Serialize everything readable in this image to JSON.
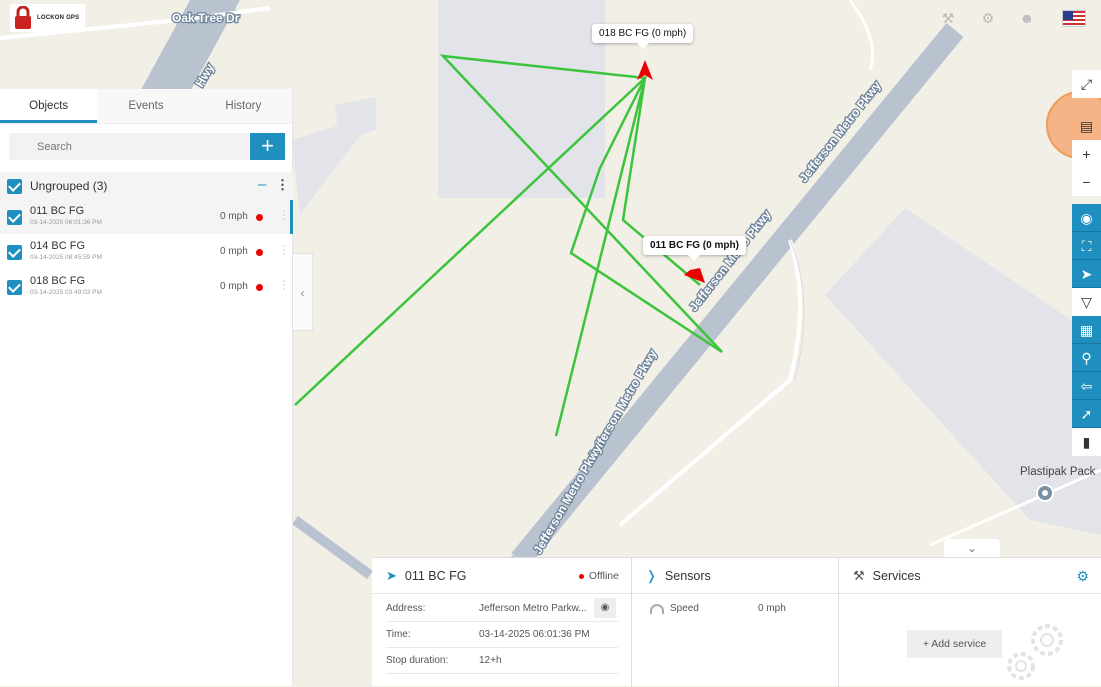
{
  "app": {
    "logo_text": "LOCKON GPS"
  },
  "map": {
    "streets": [
      "Oak Tree Dr",
      "Hwy",
      "Jefferson Metro Pkwy",
      "Jefferson Metro Pkwy",
      "Jefferson Metro Pkwy",
      "Jefferson Metro Pkwy"
    ],
    "poi": "Plastipak Pack",
    "callouts": [
      "018 BC FG (0 mph)",
      "011 BC FG (0 mph)"
    ]
  },
  "tabs": [
    "Objects",
    "Events",
    "History"
  ],
  "search": {
    "placeholder": "Search",
    "add_label": "+"
  },
  "group": {
    "label": "Ungrouped (3)",
    "collapse": "–"
  },
  "objects": [
    {
      "name": "011 BC FG",
      "time": "03-14-2025 06:01:36 PM",
      "speed": "0 mph",
      "status_color": "#e00000"
    },
    {
      "name": "014 BC FG",
      "time": "03-14-2025 08:45:59 PM",
      "speed": "0 mph",
      "status_color": "#e00000"
    },
    {
      "name": "018 BC FG",
      "time": "03-14-2025 03:49:03 PM",
      "speed": "0 mph",
      "status_color": "#e00000"
    }
  ],
  "rightbar": {
    "icons": [
      "fullscreen-icon",
      "map-layers-icon",
      "zoom-in-icon",
      "zoom-out-icon",
      "radar-icon",
      "fit-icon",
      "navigate-icon",
      "filter-icon",
      "road-icon",
      "pin-icon",
      "route-icon",
      "direction-icon",
      "traffic-light-icon"
    ],
    "zoom_in": "+",
    "zoom_out": "−"
  },
  "details": {
    "title": "011 BC FG",
    "status": "Offline",
    "rows": [
      {
        "label": "Address:",
        "value": "Jefferson Metro Parkw..."
      },
      {
        "label": "Time:",
        "value": "03-14-2025 06:01:36 PM"
      },
      {
        "label": "Stop duration:",
        "value": "12+h"
      }
    ]
  },
  "sensors": {
    "title": "Sensors",
    "items": [
      {
        "label": "Speed",
        "value": "0 mph"
      }
    ]
  },
  "services": {
    "title": "Services",
    "add_label": "+ Add service"
  },
  "colors": {
    "accent": "#1f8fbf",
    "track": "#3cc43c",
    "status_offline": "#e00000"
  }
}
